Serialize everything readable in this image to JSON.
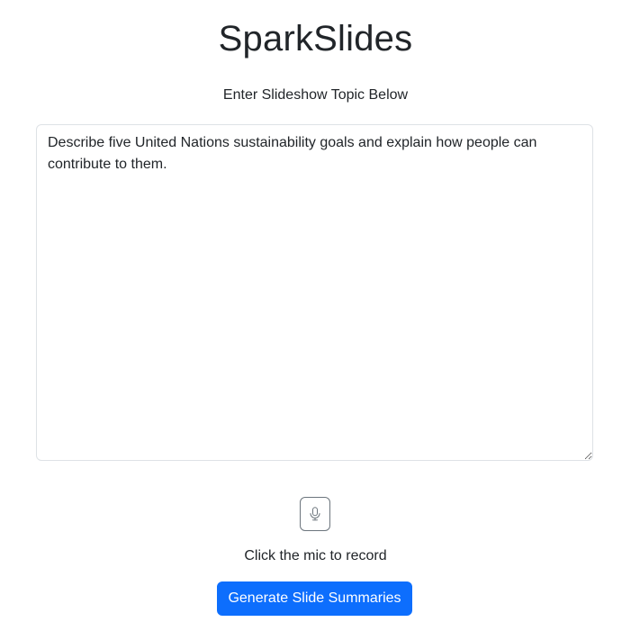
{
  "header": {
    "title": "SparkSlides",
    "prompt_label": "Enter Slideshow Topic Below"
  },
  "topic_input": {
    "value": "Describe five United Nations sustainability goals and explain how people can contribute to them."
  },
  "mic": {
    "icon": "microphone-icon",
    "caption": "Click the mic to record"
  },
  "actions": {
    "generate_label": "Generate Slide Summaries"
  },
  "colors": {
    "primary": "#0d6efd",
    "text": "#212529",
    "border": "#dee2e6",
    "mic_border": "#6c757d"
  }
}
